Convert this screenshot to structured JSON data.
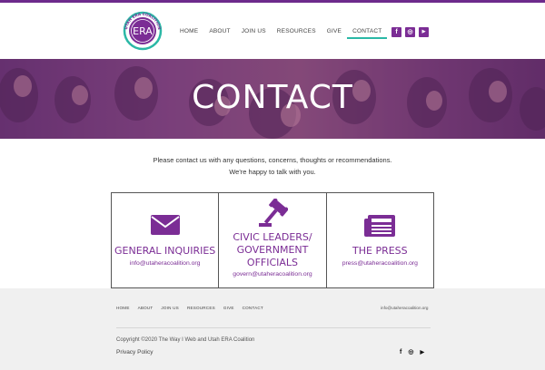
{
  "logo": {
    "top_text": "UTAH ERA COALITION",
    "center_text": "ERA"
  },
  "nav": {
    "items": [
      {
        "label": "HOME"
      },
      {
        "label": "ABOUT"
      },
      {
        "label": "JOIN US"
      },
      {
        "label": "RESOURCES"
      },
      {
        "label": "GIVE"
      },
      {
        "label": "CONTACT"
      }
    ],
    "active": "CONTACT"
  },
  "social": {
    "facebook": "f",
    "instagram": "◎",
    "youtube": "▶"
  },
  "hero": {
    "title": "CONTACT"
  },
  "intro": {
    "line1": "Please contact us with any questions, concerns, thoughts or recommendations.",
    "line2": "We're happy to talk with you."
  },
  "cards": [
    {
      "icon": "envelope-icon",
      "title_lines": [
        "GENERAL INQUIRIES"
      ],
      "email": "info@utaheracoalition.org"
    },
    {
      "icon": "gavel-icon",
      "title_lines": [
        "CIVIC LEADERS/",
        "GOVERNMENT",
        "OFFICIALS"
      ],
      "email": "govern@utaheracoalition.org"
    },
    {
      "icon": "newspaper-icon",
      "title_lines": [
        "THE PRESS"
      ],
      "email": "press@utaheracoalition.org"
    }
  ],
  "footer": {
    "nav": [
      "HOME",
      "ABOUT",
      "JOIN US",
      "RESOURCES",
      "GIVE",
      "CONTACT"
    ],
    "email": "info@utaheracoalition.org",
    "copyright": "Copyright ©2020 The Way I Web and Utah ERA Coalition",
    "privacy": "Privacy Policy"
  },
  "colors": {
    "brand_purple": "#7b2d95",
    "accent_teal": "#2bb8a6",
    "footer_bg": "#f0f0f0"
  }
}
